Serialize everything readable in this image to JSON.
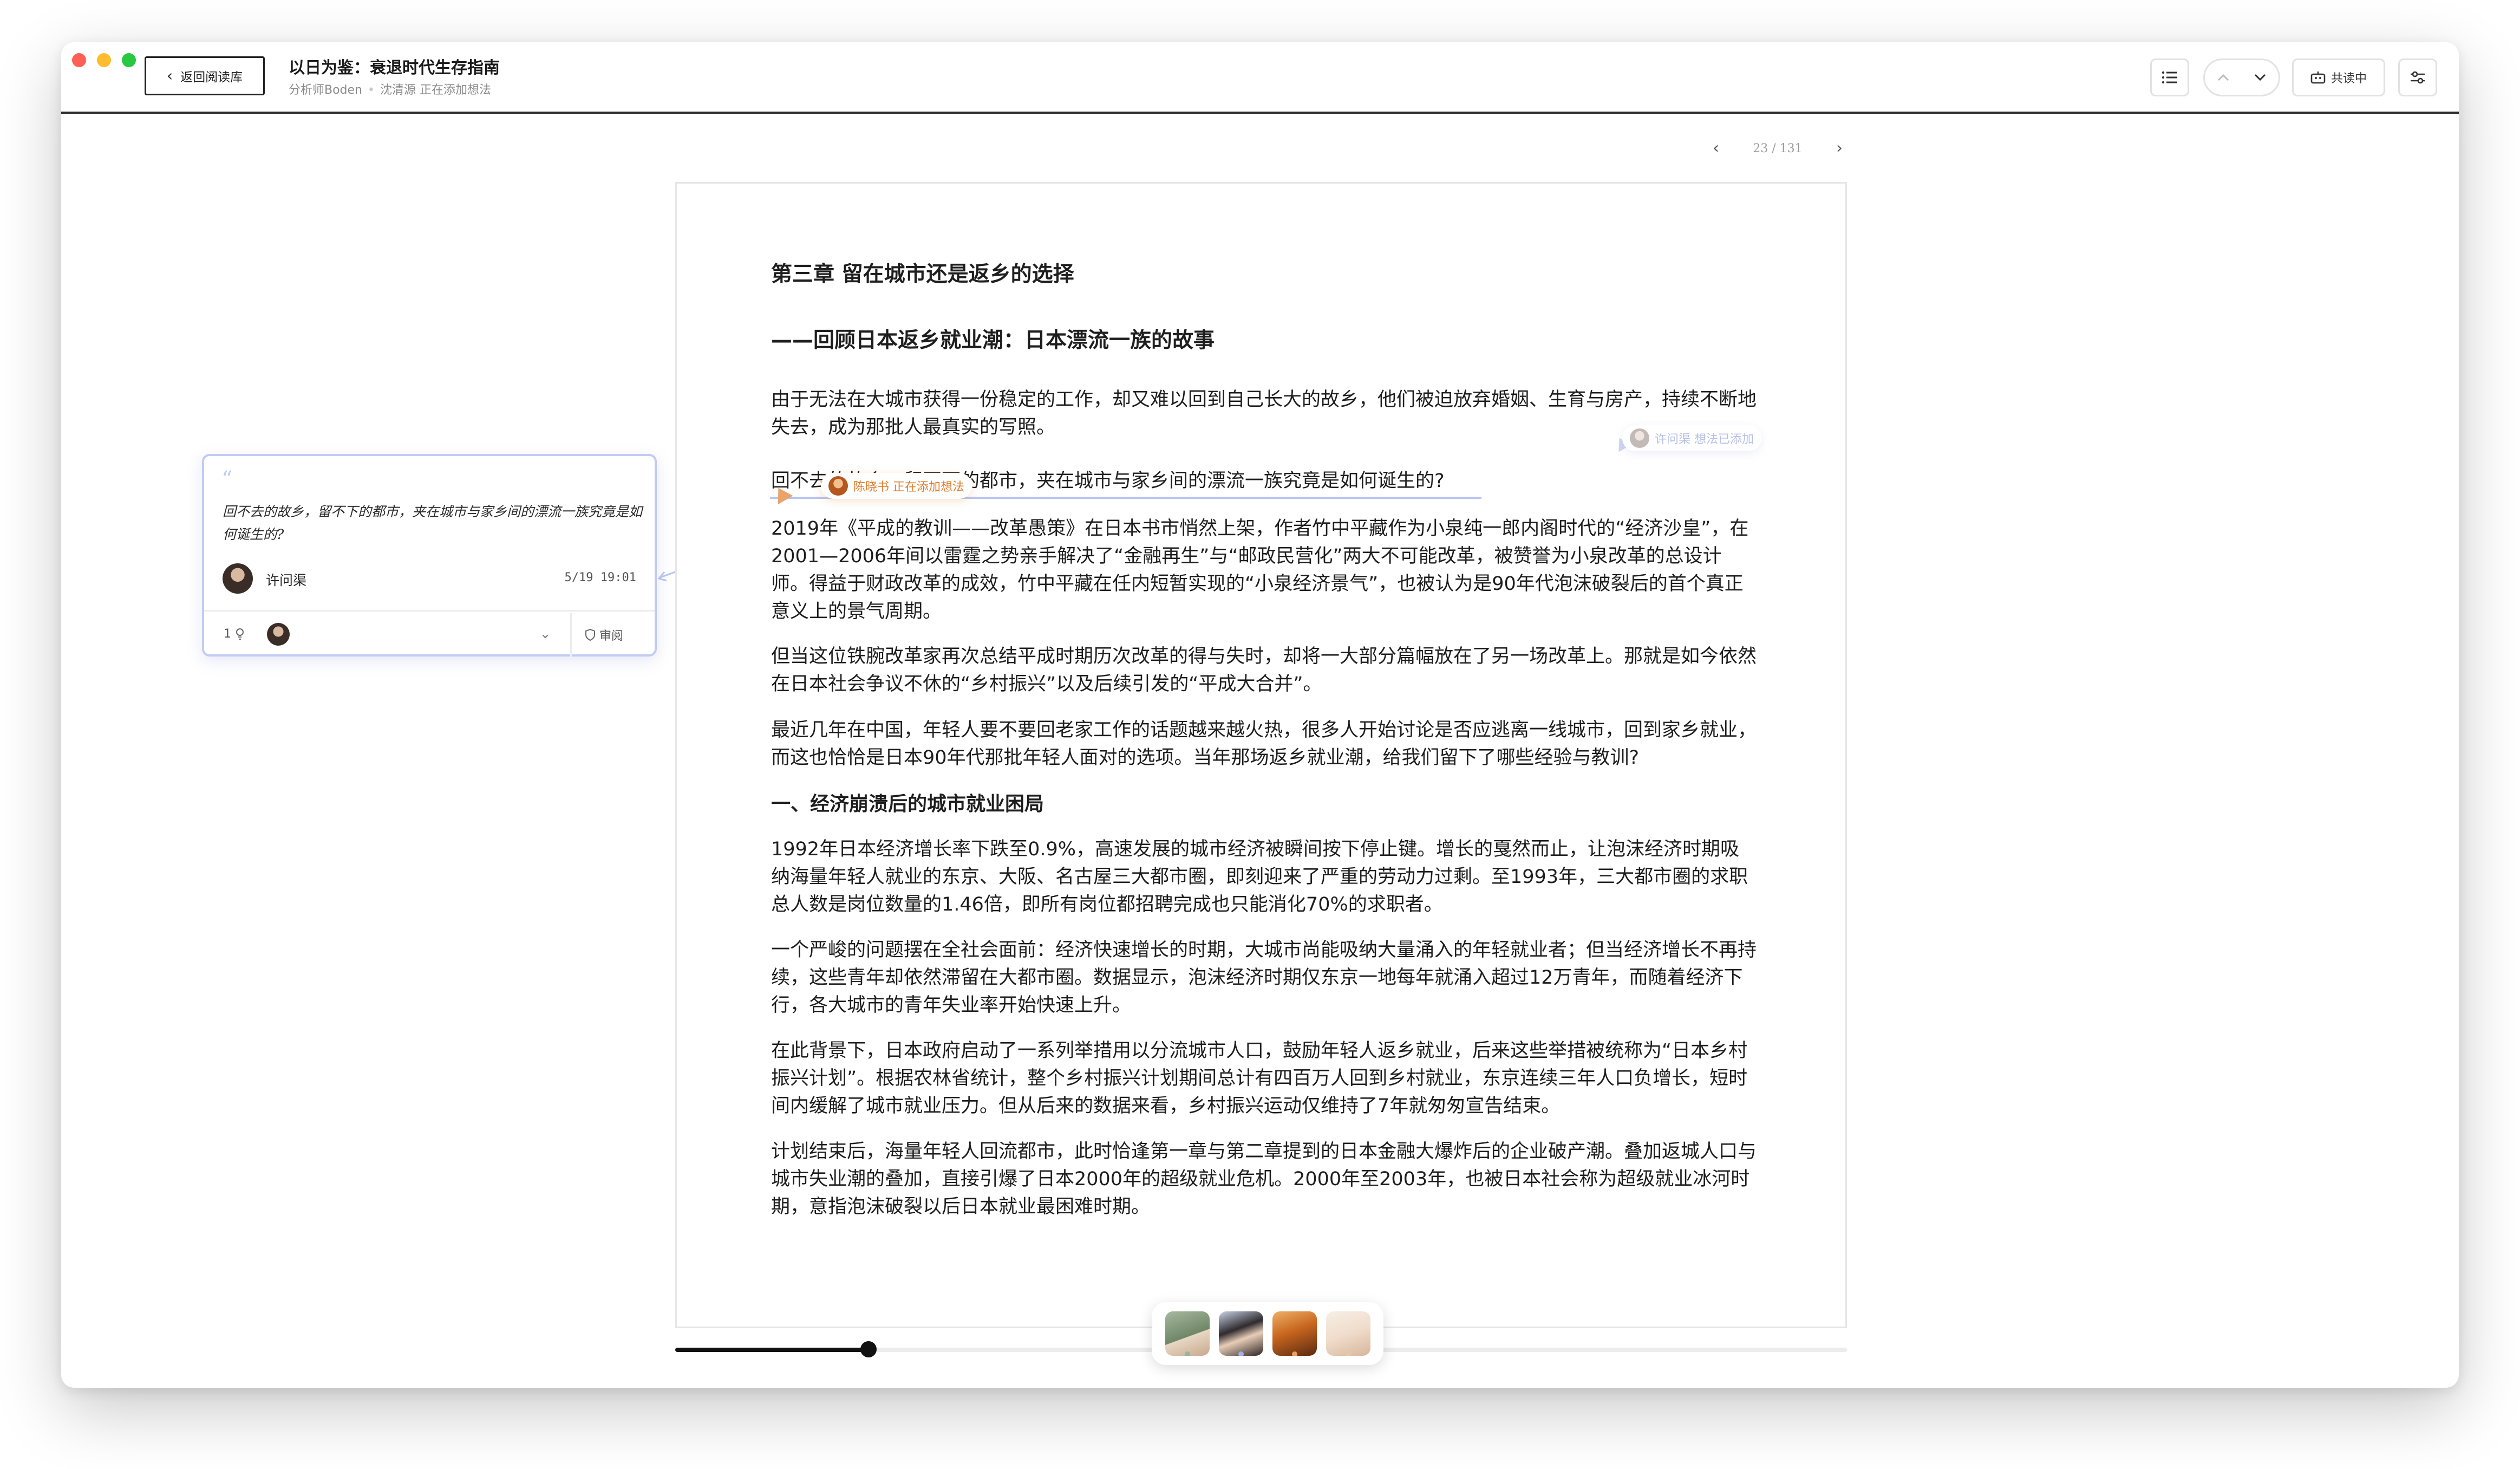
{
  "window": {
    "back_label": "返回阅读库",
    "book_title": "以日为鉴：衰退时代生存指南",
    "subtitle_author": "分析师Boden",
    "subtitle_status": "沈清源 正在添加想法",
    "share_label": "共读中"
  },
  "pager": {
    "prev": "‹",
    "next": "›",
    "page_text": "23 / 131"
  },
  "article": {
    "chapter": "第三章 留在城市还是返乡的选择",
    "subtitle": "——回顾日本返乡就业潮：日本漂流一族的故事",
    "p1": "由于无法在大城市获得一份稳定的工作，却又难以回到自己长大的故乡，他们被迫放弃婚姻、生育与房产，持续不断地失去，成为那批人最真实的写照。",
    "p2": "回不去的故乡，留不下的都市，夹在城市与家乡间的漂流一族究竟是如何诞生的?",
    "p3": "2019年《平成的教训——改革愚策》在日本书市悄然上架，作者竹中平藏作为小泉纯一郎内阁时代的“经济沙皇”，在2001—2006年间以雷霆之势亲手解决了“金融再生”与“邮政民营化”两大不可能改革，被赞誉为小泉改革的总设计师。得益于财政改革的成效，竹中平藏在任内短暂实现的“小泉经济景气”，也被认为是90年代泡沫破裂后的首个真正意义上的景气周期。",
    "p4": "但当这位铁腕改革家再次总结平成时期历次改革的得与失时，却将一大部分篇幅放在了另一场改革上。那就是如今依然在日本社会争议不休的“乡村振兴”以及后续引发的“平成大合并”。",
    "p5": "最近几年在中国，年轻人要不要回老家工作的话题越来越火热，很多人开始讨论是否应逃离一线城市，回到家乡就业，而这也恰恰是日本90年代那批年轻人面对的选项。当年那场返乡就业潮，给我们留下了哪些经验与教训?",
    "section1": "一、经济崩溃后的城市就业困局",
    "p6": "1992年日本经济增长率下跌至0.9%，高速发展的城市经济被瞬间按下停止键。增长的戛然而止，让泡沫经济时期吸纳海量年轻人就业的东京、大阪、名古屋三大都市圈，即刻迎来了严重的劳动力过剩。至1993年，三大都市圈的求职总人数是岗位数量的1.46倍，即所有岗位都招聘完成也只能消化70%的求职者。",
    "p7": "一个严峻的问题摆在全社会面前：经济快速增长的时期，大城市尚能吸纳大量涌入的年轻就业者；但当经济增长不再持续，这些青年却依然滞留在大都市圈。数据显示，泡沫经济时期仅东京一地每年就涌入超过12万青年，而随着经济下行，各大城市的青年失业率开始快速上升。",
    "p8": "在此背景下，日本政府启动了一系列举措用以分流城市人口，鼓励年轻人返乡就业，后来这些举措被统称为“日本乡村振兴计划”。根据农林省统计，整个乡村振兴计划期间总计有四百万人回到乡村就业，东京连续三年人口负增长，短时间内缓解了城市就业压力。但从后来的数据来看，乡村振兴运动仅维持了7年就匆匆宣告结束。",
    "p9": "计划结束后，海量年轻人回流都市，此时恰逢第一章与第二章提到的日本金融大爆炸后的企业破产潮。叠加返城人口与城市失业潮的叠加，直接引爆了日本2000年的超级就业危机。2000年至2003年，也被日本社会称为超级就业冰河时期，意指泡沫破裂以后日本就业最困难时期。"
  },
  "presence": {
    "active_user": "陈晓书 正在添加想法",
    "faded_user": "许问渠 想法已添加"
  },
  "note": {
    "quote": "回不去的故乡，留不下的都市，夹在城市与家乡间的漂流一族究竟是如何诞生的?",
    "author": "许问渠",
    "time": "5/19 19:01",
    "count": "1",
    "review_label": "审阅"
  },
  "progress": {
    "value": 0.165
  },
  "readers": [
    {
      "name": "reader-1",
      "dot_color": "#8fb7a1"
    },
    {
      "name": "reader-2",
      "dot_color": "#9fb1e8"
    },
    {
      "name": "reader-3",
      "dot_color": "#f0a05a"
    },
    {
      "name": "reader-4",
      "dot_color": "#e8c7a6"
    }
  ],
  "colors": {
    "highlight_underline": "#b9c4f2",
    "accent_orange": "#e07b2a",
    "card_border": "#c2cbf4"
  }
}
